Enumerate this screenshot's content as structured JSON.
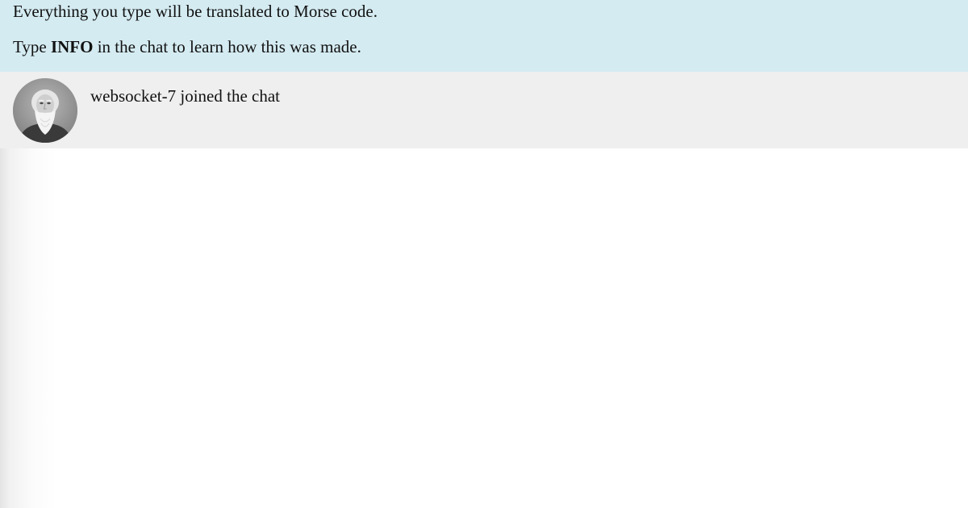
{
  "banner": {
    "line1": "Everything you type will be translated to Morse code.",
    "line2_prefix": "Type ",
    "line2_keyword": "INFO",
    "line2_suffix": " in the chat to learn how this was made."
  },
  "messages": [
    {
      "avatar_icon": "samuel-morse-portrait",
      "text": "websocket-7 joined the chat"
    }
  ],
  "colors": {
    "banner_background": "#d4ebf1",
    "message_background": "#efefef",
    "page_background": "#ffffff",
    "text": "#111111"
  }
}
